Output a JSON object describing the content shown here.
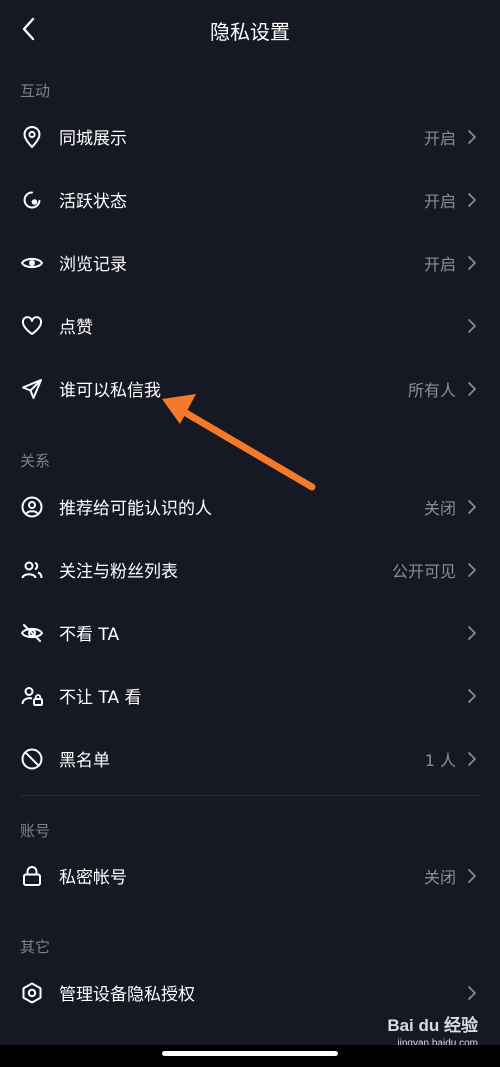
{
  "header": {
    "title": "隐私设置",
    "back_icon": "chevron-left-icon"
  },
  "sections": [
    {
      "label": "互动",
      "items": [
        {
          "icon": "location-pin-icon",
          "label": "同城展示",
          "value": "开启"
        },
        {
          "icon": "activity-status-icon",
          "label": "活跃状态",
          "value": "开启"
        },
        {
          "icon": "eye-icon",
          "label": "浏览记录",
          "value": "开启"
        },
        {
          "icon": "heart-icon",
          "label": "点赞",
          "value": ""
        },
        {
          "icon": "send-icon",
          "label": "谁可以私信我",
          "value": "所有人"
        }
      ]
    },
    {
      "label": "关系",
      "items": [
        {
          "icon": "user-circle-icon",
          "label": "推荐给可能认识的人",
          "value": "关闭"
        },
        {
          "icon": "users-icon",
          "label": "关注与粉丝列表",
          "value": "公开可见"
        },
        {
          "icon": "eye-off-icon",
          "label": "不看 TA",
          "value": ""
        },
        {
          "icon": "user-lock-icon",
          "label": "不让 TA 看",
          "value": ""
        },
        {
          "icon": "block-icon",
          "label": "黑名单",
          "value": "1 人"
        }
      ]
    },
    {
      "label": "账号",
      "items": [
        {
          "icon": "lock-icon",
          "label": "私密帐号",
          "value": "关闭"
        }
      ]
    },
    {
      "label": "其它",
      "items": [
        {
          "icon": "hexagon-icon",
          "label": "管理设备隐私授权",
          "value": ""
        }
      ]
    }
  ],
  "annotation": {
    "arrow_color": "#F47A2A"
  },
  "watermark": {
    "logo": "Bai du 经验",
    "url": "jingyan.baidu.com"
  },
  "colors": {
    "background": "#161823",
    "text": "#FFFFFF",
    "secondary": "#8A8B91"
  }
}
